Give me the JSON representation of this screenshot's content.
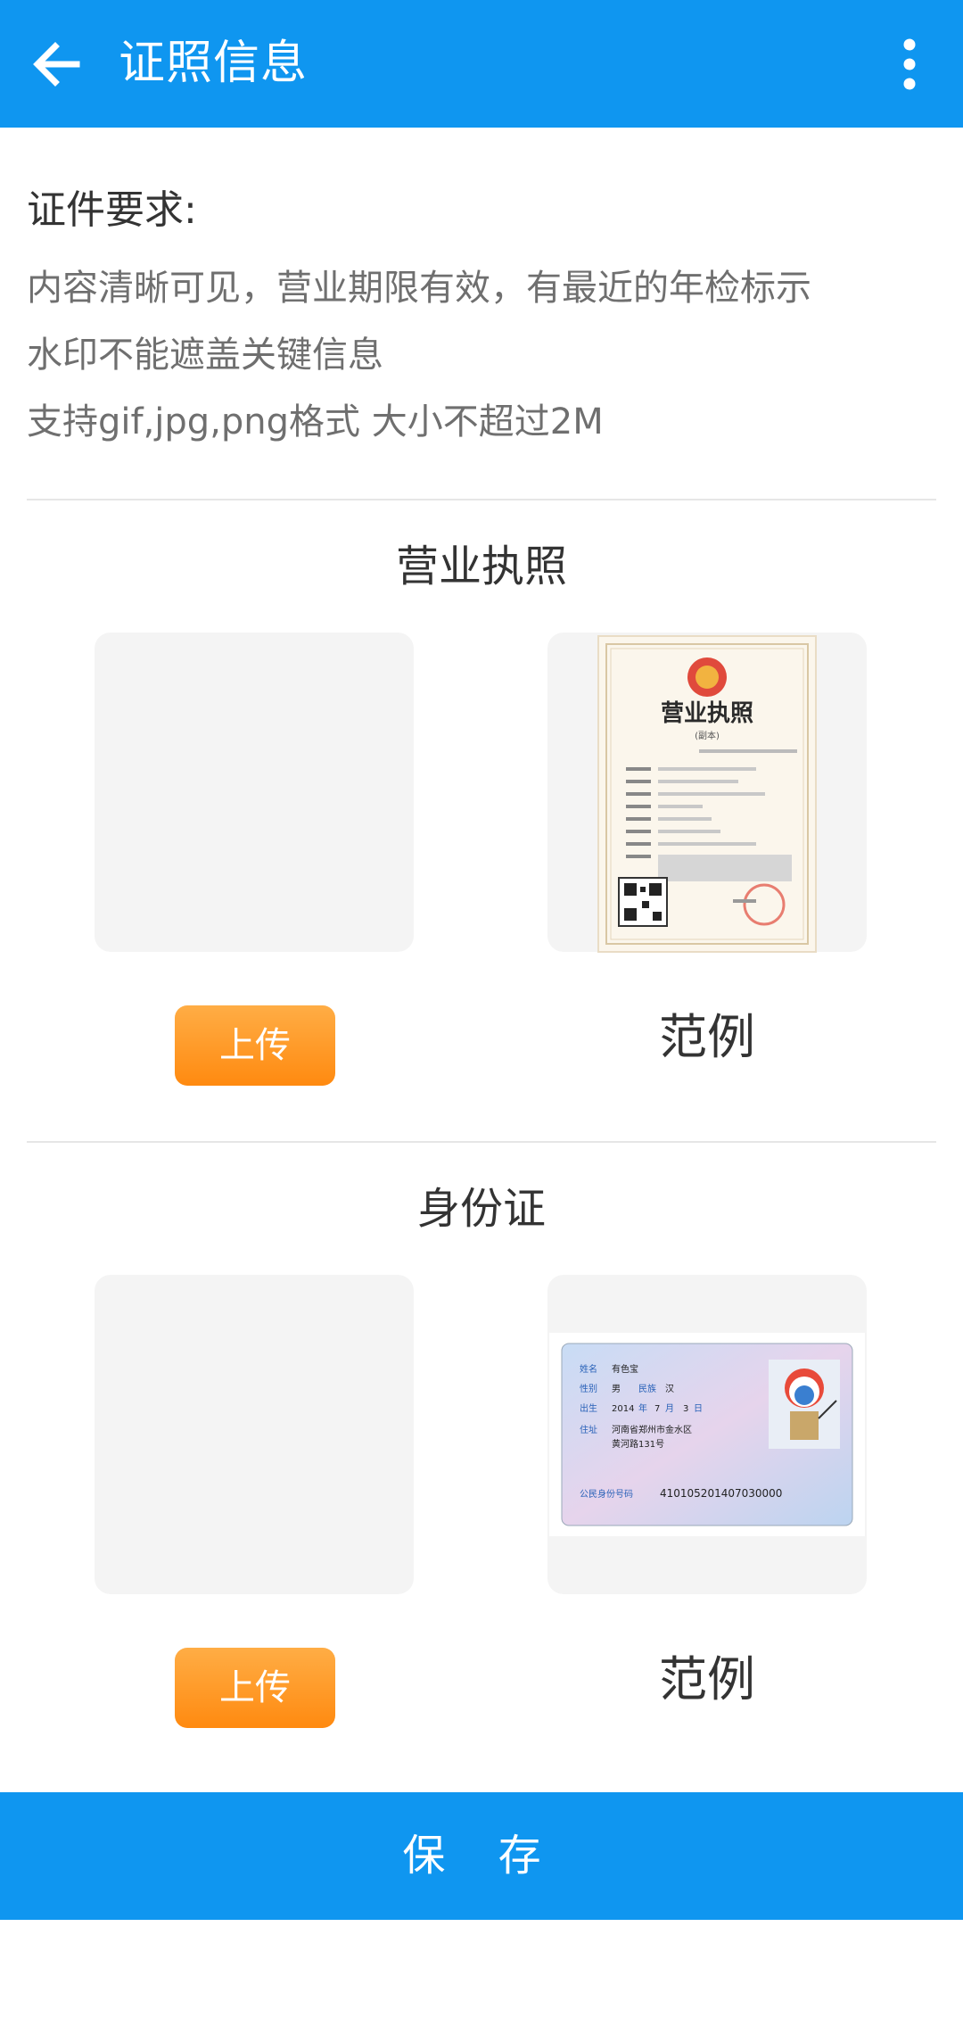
{
  "appbar": {
    "title": "证照信息",
    "back_icon": "arrow-left-icon",
    "more_icon": "more-vertical-icon"
  },
  "requirements": {
    "title": "证件要求:",
    "lines": [
      "内容清晰可见，营业期限有效，有最近的年检标示",
      "水印不能遮盖关键信息",
      "支持gif,jpg,png格式 大小不超过2M"
    ]
  },
  "business_license": {
    "title": "营业执照",
    "upload_label": "上传",
    "example_label": "范例",
    "sample": {
      "heading": "营业执照",
      "subheading": "(副本)"
    }
  },
  "id_card": {
    "title": "身份证",
    "upload_label": "上传",
    "example_label": "范例",
    "sample": {
      "name_label": "姓名",
      "name": "有色宝",
      "gender_label": "性别",
      "gender": "男",
      "ethnicity_label": "民族",
      "ethnicity": "汉",
      "birth_label": "出生",
      "birth_year": "2014",
      "year_unit": "年",
      "birth_month": "7",
      "month_unit": "月",
      "birth_day": "3",
      "day_unit": "日",
      "address_label": "住址",
      "address_line1": "河南省郑州市金水区",
      "address_line2": "黄河路131号",
      "id_label": "公民身份号码",
      "id_number": "410105201407030000"
    }
  },
  "save_label": "保 存",
  "colors": {
    "primary": "#0f96f0",
    "upload_button": "#ff8a10",
    "placeholder_box": "#f4f4f4"
  }
}
